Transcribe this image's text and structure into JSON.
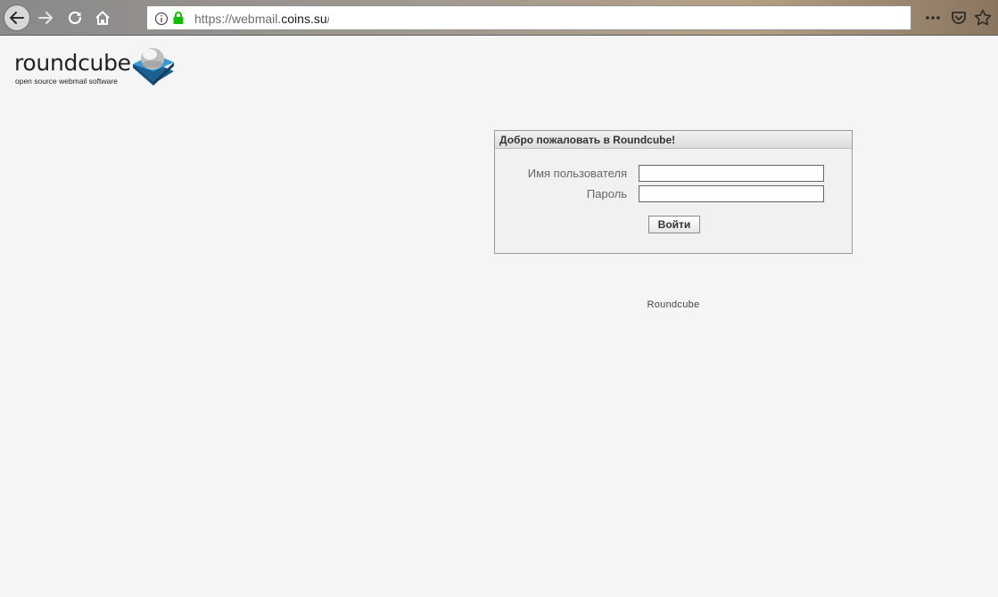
{
  "browser": {
    "url_prefix": "https://webmail.",
    "url_host": "coins.su",
    "url_suffix": "/",
    "icons": {
      "back": "arrow-left-icon",
      "forward": "arrow-right-icon",
      "reload": "reload-icon",
      "home": "home-icon",
      "info": "info-icon",
      "lock": "lock-icon",
      "more": "ellipsis-icon",
      "pocket": "pocket-icon",
      "bookmark": "star-icon"
    },
    "colors": {
      "lock": "#12bc00"
    }
  },
  "logo": {
    "wordmark": "roundcube",
    "tagline": "open source webmail software",
    "colors": {
      "cube": "#2a86c6"
    }
  },
  "login": {
    "title": "Добро пожаловать в Roundcube!",
    "username_label": "Имя пользователя",
    "username_value": "",
    "password_label": "Пароль",
    "password_value": "",
    "submit_label": "Войти"
  },
  "footer": {
    "text": "Roundcube"
  }
}
